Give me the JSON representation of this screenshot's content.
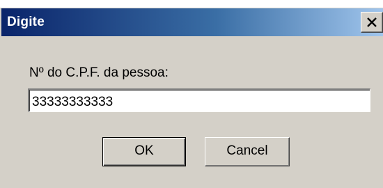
{
  "dialog": {
    "title": "Digite",
    "prompt": "Nº do C.P.F. da pessoa:",
    "input_value": "33333333333",
    "ok_label": "OK",
    "cancel_label": "Cancel",
    "close_icon": "close-icon"
  },
  "colors": {
    "titlebar_start": "#0a246a",
    "titlebar_end": "#a6caf0",
    "face": "#d4d0c8"
  }
}
